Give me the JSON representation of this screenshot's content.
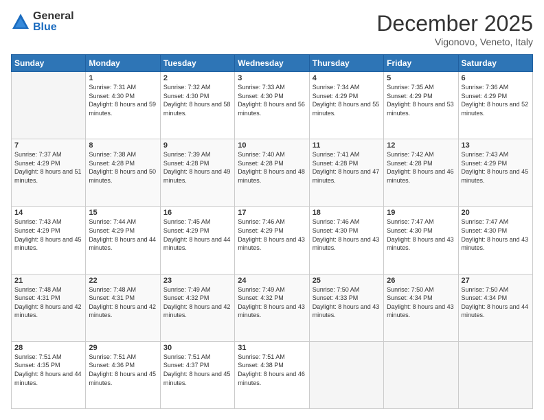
{
  "logo": {
    "general": "General",
    "blue": "Blue"
  },
  "header": {
    "month": "December 2025",
    "location": "Vigonovo, Veneto, Italy"
  },
  "weekdays": [
    "Sunday",
    "Monday",
    "Tuesday",
    "Wednesday",
    "Thursday",
    "Friday",
    "Saturday"
  ],
  "weeks": [
    [
      null,
      {
        "day": 1,
        "sunrise": "7:31 AM",
        "sunset": "4:30 PM",
        "daylight": "8 hours and 59 minutes."
      },
      {
        "day": 2,
        "sunrise": "7:32 AM",
        "sunset": "4:30 PM",
        "daylight": "8 hours and 58 minutes."
      },
      {
        "day": 3,
        "sunrise": "7:33 AM",
        "sunset": "4:30 PM",
        "daylight": "8 hours and 56 minutes."
      },
      {
        "day": 4,
        "sunrise": "7:34 AM",
        "sunset": "4:29 PM",
        "daylight": "8 hours and 55 minutes."
      },
      {
        "day": 5,
        "sunrise": "7:35 AM",
        "sunset": "4:29 PM",
        "daylight": "8 hours and 53 minutes."
      },
      {
        "day": 6,
        "sunrise": "7:36 AM",
        "sunset": "4:29 PM",
        "daylight": "8 hours and 52 minutes."
      }
    ],
    [
      {
        "day": 7,
        "sunrise": "7:37 AM",
        "sunset": "4:29 PM",
        "daylight": "8 hours and 51 minutes."
      },
      {
        "day": 8,
        "sunrise": "7:38 AM",
        "sunset": "4:28 PM",
        "daylight": "8 hours and 50 minutes."
      },
      {
        "day": 9,
        "sunrise": "7:39 AM",
        "sunset": "4:28 PM",
        "daylight": "8 hours and 49 minutes."
      },
      {
        "day": 10,
        "sunrise": "7:40 AM",
        "sunset": "4:28 PM",
        "daylight": "8 hours and 48 minutes."
      },
      {
        "day": 11,
        "sunrise": "7:41 AM",
        "sunset": "4:28 PM",
        "daylight": "8 hours and 47 minutes."
      },
      {
        "day": 12,
        "sunrise": "7:42 AM",
        "sunset": "4:28 PM",
        "daylight": "8 hours and 46 minutes."
      },
      {
        "day": 13,
        "sunrise": "7:43 AM",
        "sunset": "4:29 PM",
        "daylight": "8 hours and 45 minutes."
      }
    ],
    [
      {
        "day": 14,
        "sunrise": "7:43 AM",
        "sunset": "4:29 PM",
        "daylight": "8 hours and 45 minutes."
      },
      {
        "day": 15,
        "sunrise": "7:44 AM",
        "sunset": "4:29 PM",
        "daylight": "8 hours and 44 minutes."
      },
      {
        "day": 16,
        "sunrise": "7:45 AM",
        "sunset": "4:29 PM",
        "daylight": "8 hours and 44 minutes."
      },
      {
        "day": 17,
        "sunrise": "7:46 AM",
        "sunset": "4:29 PM",
        "daylight": "8 hours and 43 minutes."
      },
      {
        "day": 18,
        "sunrise": "7:46 AM",
        "sunset": "4:30 PM",
        "daylight": "8 hours and 43 minutes."
      },
      {
        "day": 19,
        "sunrise": "7:47 AM",
        "sunset": "4:30 PM",
        "daylight": "8 hours and 43 minutes."
      },
      {
        "day": 20,
        "sunrise": "7:47 AM",
        "sunset": "4:30 PM",
        "daylight": "8 hours and 43 minutes."
      }
    ],
    [
      {
        "day": 21,
        "sunrise": "7:48 AM",
        "sunset": "4:31 PM",
        "daylight": "8 hours and 42 minutes."
      },
      {
        "day": 22,
        "sunrise": "7:48 AM",
        "sunset": "4:31 PM",
        "daylight": "8 hours and 42 minutes."
      },
      {
        "day": 23,
        "sunrise": "7:49 AM",
        "sunset": "4:32 PM",
        "daylight": "8 hours and 42 minutes."
      },
      {
        "day": 24,
        "sunrise": "7:49 AM",
        "sunset": "4:32 PM",
        "daylight": "8 hours and 43 minutes."
      },
      {
        "day": 25,
        "sunrise": "7:50 AM",
        "sunset": "4:33 PM",
        "daylight": "8 hours and 43 minutes."
      },
      {
        "day": 26,
        "sunrise": "7:50 AM",
        "sunset": "4:34 PM",
        "daylight": "8 hours and 43 minutes."
      },
      {
        "day": 27,
        "sunrise": "7:50 AM",
        "sunset": "4:34 PM",
        "daylight": "8 hours and 44 minutes."
      }
    ],
    [
      {
        "day": 28,
        "sunrise": "7:51 AM",
        "sunset": "4:35 PM",
        "daylight": "8 hours and 44 minutes."
      },
      {
        "day": 29,
        "sunrise": "7:51 AM",
        "sunset": "4:36 PM",
        "daylight": "8 hours and 45 minutes."
      },
      {
        "day": 30,
        "sunrise": "7:51 AM",
        "sunset": "4:37 PM",
        "daylight": "8 hours and 45 minutes."
      },
      {
        "day": 31,
        "sunrise": "7:51 AM",
        "sunset": "4:38 PM",
        "daylight": "8 hours and 46 minutes."
      },
      null,
      null,
      null
    ]
  ],
  "labels": {
    "sunrise": "Sunrise:",
    "sunset": "Sunset:",
    "daylight": "Daylight:"
  }
}
